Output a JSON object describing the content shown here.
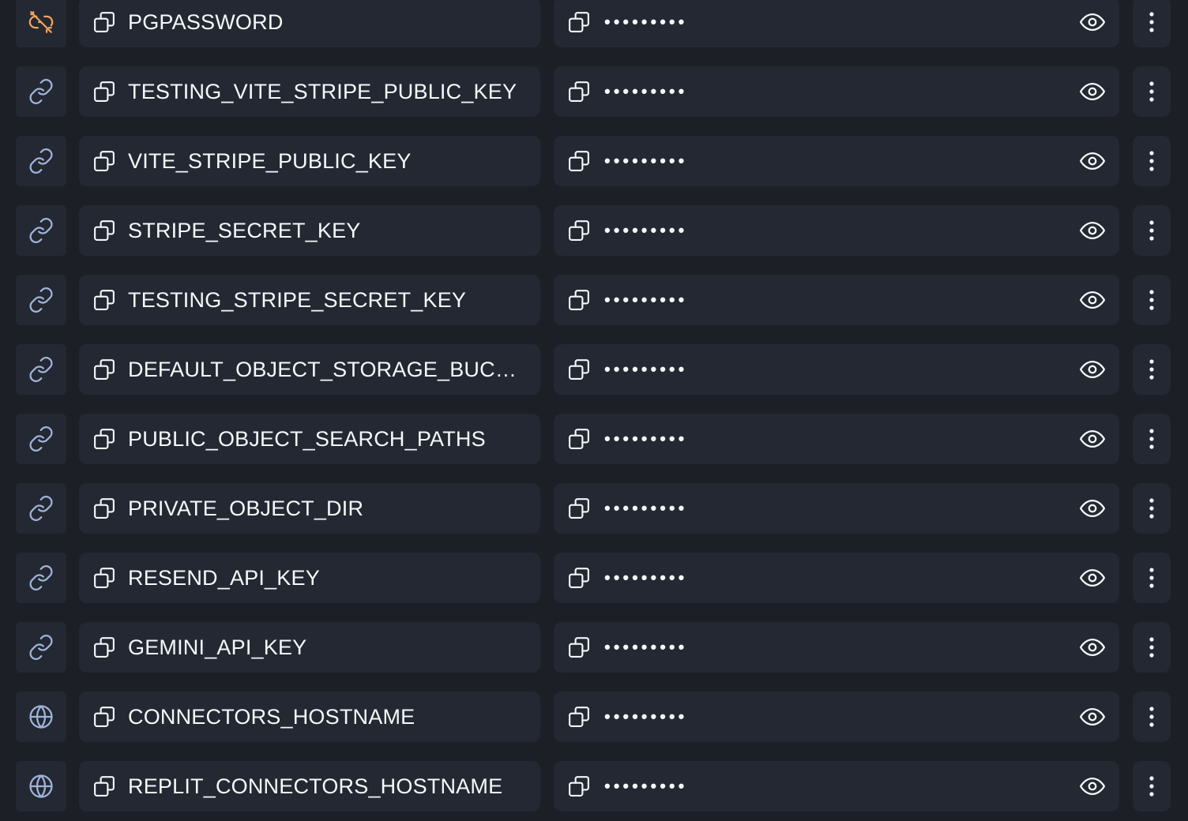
{
  "secrets": [
    {
      "status_icon": "broken-link-icon",
      "status_color": "#f0a35e",
      "key": "PGPASSWORD",
      "value_display": "•••••••••"
    },
    {
      "status_icon": "link-icon",
      "status_color": "#9fb4d9",
      "key": "TESTING_VITE_STRIPE_PUBLIC_KEY",
      "value_display": "•••••••••"
    },
    {
      "status_icon": "link-icon",
      "status_color": "#9fb4d9",
      "key": "VITE_STRIPE_PUBLIC_KEY",
      "value_display": "•••••••••"
    },
    {
      "status_icon": "link-icon",
      "status_color": "#9fb4d9",
      "key": "STRIPE_SECRET_KEY",
      "value_display": "•••••••••"
    },
    {
      "status_icon": "link-icon",
      "status_color": "#9fb4d9",
      "key": "TESTING_STRIPE_SECRET_KEY",
      "value_display": "•••••••••"
    },
    {
      "status_icon": "link-icon",
      "status_color": "#9fb4d9",
      "key": "DEFAULT_OBJECT_STORAGE_BUCKET…",
      "value_display": "•••••••••"
    },
    {
      "status_icon": "link-icon",
      "status_color": "#9fb4d9",
      "key": "PUBLIC_OBJECT_SEARCH_PATHS",
      "value_display": "•••••••••"
    },
    {
      "status_icon": "link-icon",
      "status_color": "#9fb4d9",
      "key": "PRIVATE_OBJECT_DIR",
      "value_display": "•••••••••"
    },
    {
      "status_icon": "link-icon",
      "status_color": "#9fb4d9",
      "key": "RESEND_API_KEY",
      "value_display": "•••••••••"
    },
    {
      "status_icon": "link-icon",
      "status_color": "#9fb4d9",
      "key": "GEMINI_API_KEY",
      "value_display": "•••••••••"
    },
    {
      "status_icon": "globe-icon",
      "status_color": "#9fb4d9",
      "key": "CONNECTORS_HOSTNAME",
      "value_display": "•••••••••"
    },
    {
      "status_icon": "globe-icon",
      "status_color": "#9fb4d9",
      "key": "REPLIT_CONNECTORS_HOSTNAME",
      "value_display": "•••••••••"
    }
  ],
  "colors": {
    "background": "#1c1f25",
    "panel": "#242832",
    "text": "#f5f9fc",
    "icon": "#f5f9fc"
  }
}
